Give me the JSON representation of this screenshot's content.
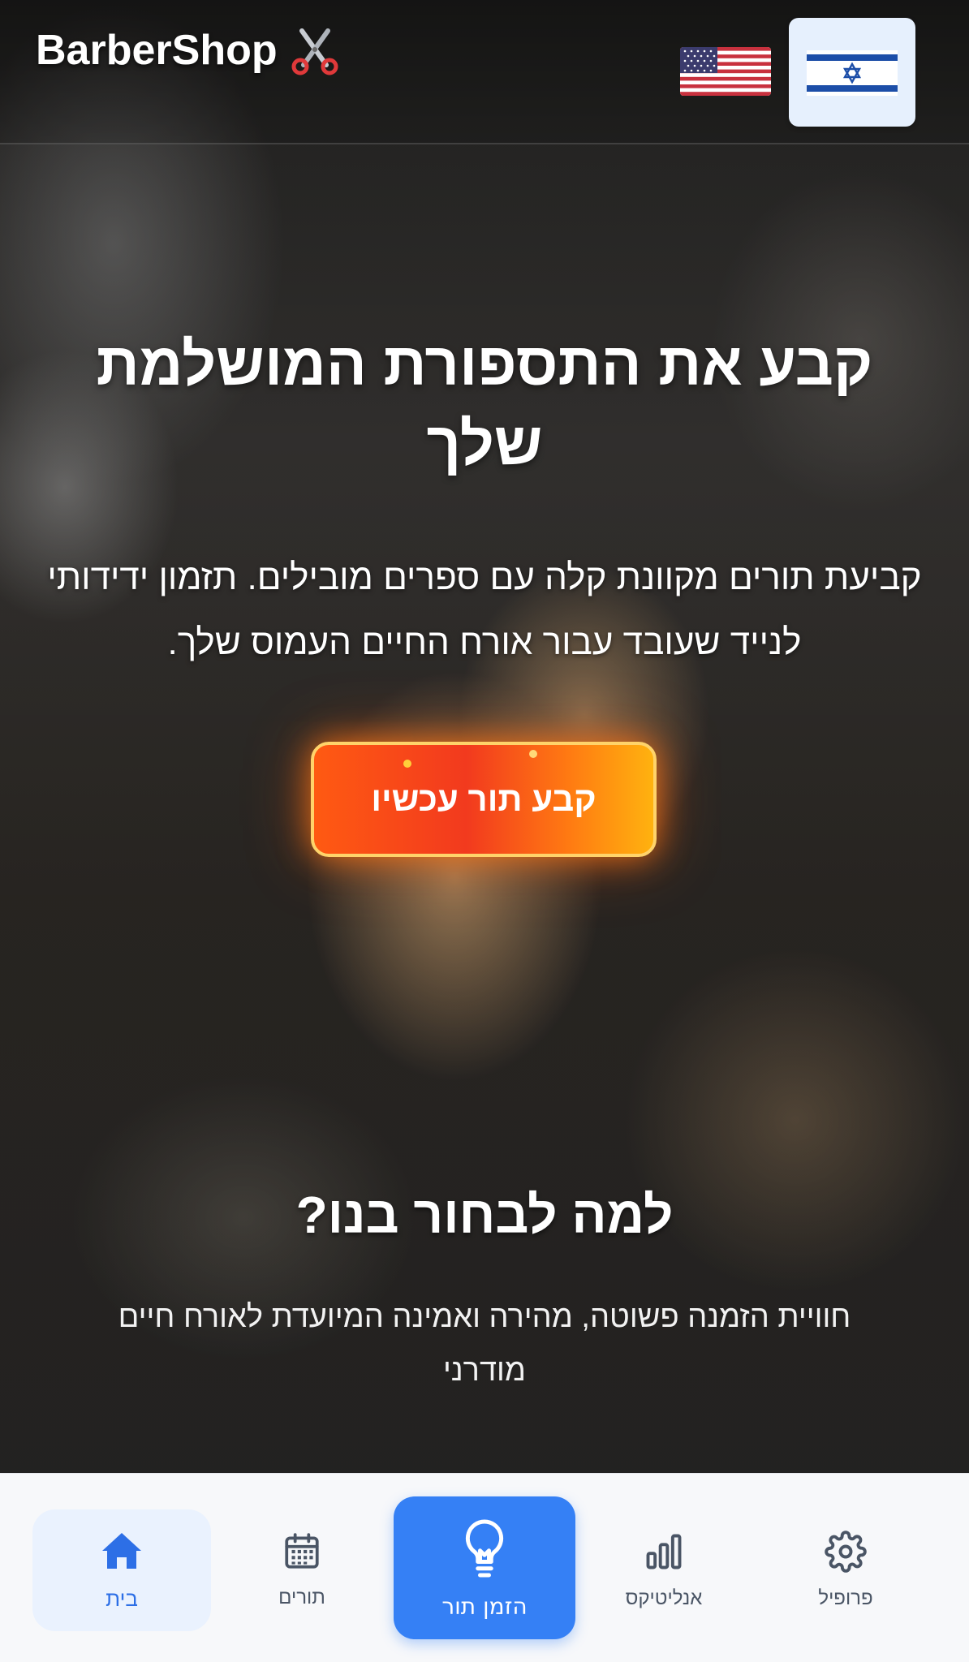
{
  "header": {
    "brand": "BarberShop",
    "languages": [
      {
        "code": "en",
        "icon": "us-flag-icon",
        "selected": false
      },
      {
        "code": "he",
        "icon": "israel-flag-icon",
        "selected": true
      }
    ]
  },
  "hero": {
    "title": "קבע את התספורת המושלמת שלך",
    "subtitle": "קביעת תורים מקוונת קלה עם ספרים מובילים. תזמון ידידותי לנייד שעובד עבור אורח החיים העמוס שלך.",
    "cta_label": "קבע תור עכשיו"
  },
  "why": {
    "title": "למה לבחור בנו?",
    "subtitle": "חוויית הזמנה פשוטה, מהירה ואמינה המיועדת לאורח חיים מודרני"
  },
  "nav": {
    "home": {
      "label": "בית",
      "icon": "home-icon",
      "active": true
    },
    "appointments": {
      "label": "תורים",
      "icon": "calendar-icon"
    },
    "book": {
      "label": "הזמן תור",
      "icon": "lightbulb-icon"
    },
    "analytics": {
      "label": "אנליטיקס",
      "icon": "bar-chart-icon"
    },
    "profile": {
      "label": "פרופיל",
      "icon": "gear-icon"
    }
  },
  "colors": {
    "accent": "#3580f5",
    "cta_start": "#ff5a12",
    "cta_end": "#ffb20f"
  }
}
